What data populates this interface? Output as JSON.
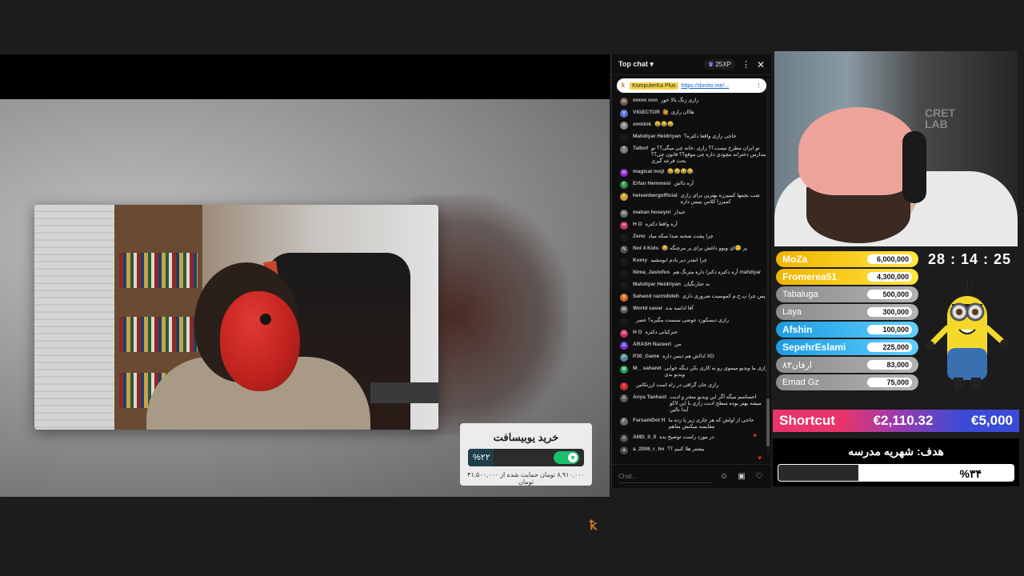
{
  "chat": {
    "header_title": "Top chat",
    "xp_label": "25XP",
    "pinned": {
      "name": "KomputerKa Plus",
      "link": "https://donito.me/..."
    },
    "messages": [
      {
        "author": "mmm nnn",
        "text": "رازی زنگ بالا خور",
        "avatar_color": "#6d5a50",
        "initial": "m"
      },
      {
        "author": "VIGECTOR",
        "text": "هااان رازی 🙋",
        "avatar_color": "#5a6fd0",
        "initial": "V"
      },
      {
        "author": "omidnk",
        "text": "😂😂😂",
        "avatar_color": "#888888",
        "initial": "o"
      },
      {
        "author": "Mahdiyar Heidriyan",
        "text": "حاجی رازی واقعا دکتره؟",
        "avatar_color": "#1a1a1a",
        "initial": ""
      },
      {
        "author": "Talbof",
        "text": "تو ایران مطرح نیست؟؟ رازی ،خانه چی میگی؟؟ تو مدارس دخترانه مچودی داره چی موقع؟؟ قانون چی؟؟ بحث قرعه گیری",
        "avatar_color": "#7a7a7a",
        "initial": "T"
      },
      {
        "author": "magical moji",
        "text": "😂😂😂😂",
        "avatar_color": "#8a2ad0",
        "initial": "m"
      },
      {
        "author": "Erfan Hemmesi",
        "text": "آره دااش",
        "avatar_color": "#2a8a4a",
        "initial": "E"
      },
      {
        "author": "heisenbergofficial",
        "text": "شب بچمها کمیپرزه بهترین برای رازی کمیرزا کلاس نیبس داره",
        "avatar_color": "#c89a3a",
        "initial": "h"
      },
      {
        "author": "mahan hoseyni",
        "text": "حیدار",
        "avatar_color": "#6a6a6a",
        "initial": "m"
      },
      {
        "author": "H O",
        "text": "آره واقعا دکتره",
        "avatar_color": "#c0306a",
        "initial": "H"
      },
      {
        "author": "Zeno",
        "text": "چرا پشت صحنه صدا سکه میاد",
        "avatar_color": "#1a1a1a",
        "initial": ""
      },
      {
        "author": "Not 4 Kids",
        "text": "پر ☺️ای ویوو داغش برای پر مرچنگه 😂",
        "avatar_color": "#4a4a4a",
        "initial": "N"
      },
      {
        "author": "Komy",
        "text": "چرا انقدر دیر یادم ابومشید",
        "avatar_color": "#1a1a1a",
        "initial": ""
      },
      {
        "author": "Nima_Jastofus",
        "text": "mahdiyar آره دکتره دکترا داره مترنگ هم",
        "avatar_color": "#1a1a1a",
        "initial": ""
      },
      {
        "author": "Mahdiyar Heidriyan",
        "text": "نه حتارنگیان",
        "avatar_color": "#1a1a1a",
        "initial": ""
      },
      {
        "author": "Sahand razmdideh",
        "text": "پس چرا پ.ج.م کموسیت ضروری داری",
        "avatar_color": "#d06a2a",
        "initial": "S"
      },
      {
        "author": "World savar",
        "text": "آقا اداسه بده",
        "avatar_color": "#5a5a5a",
        "initial": "W"
      },
      {
        "author": "",
        "text": "رازی دیسکورد عوضی سسنت مگیره؟ عصر",
        "avatar_color": "#1a1a1a",
        "initial": ""
      },
      {
        "author": "H O",
        "text": "حترکیانی دکتره",
        "avatar_color": "#c0306a",
        "initial": "H"
      },
      {
        "author": "ARASH Nazeeri",
        "text": "من",
        "avatar_color": "#6a3ad0",
        "initial": "A"
      },
      {
        "author": "P30_Game",
        "text": "XD ادااش هم دیس داره",
        "avatar_color": "#4a8a9a",
        "initial": "P"
      },
      {
        "author": "M__sahand",
        "text": "رازی ما ویدیو میموی رو به کاری بکن دیگه خوابی ویدیو بدی",
        "avatar_color": "#2a9a5a",
        "initial": "M"
      },
      {
        "author": "",
        "text": "رازی جان گرافی در راه است ازرنکاس",
        "avatar_color": "#d02a2a",
        "initial": "I"
      },
      {
        "author": "Anya Tanhast",
        "text": "احساسم میگه اگر این ویدیو منجر و ادیت میشه بهتر بوده سطح ادیت رازی با این لاکو آیدا بالین",
        "avatar_color": "#5a5a5a",
        "initial": "A"
      },
      {
        "author": "FarsamDot H",
        "text": "حاجی از اولش که هر چاری زیر پا زده ما مقایسه میکنش متاهم",
        "avatar_color": "#6a6a6a",
        "initial": "F"
      },
      {
        "author": "AMD_0_0",
        "text": "در مورد راست توضیح بده",
        "avatar_color": "#4a4a4a",
        "initial": "A"
      },
      {
        "author": "a_2006_r_hn",
        "text": "بیشتر هلا کنیم ؟؟",
        "avatar_color": "#4a4a4a",
        "initial": "a"
      }
    ],
    "input_placeholder": "Chat..."
  },
  "video": {
    "donate_title": "خرید یوبیسافت",
    "donate_percent_label": "%۲۲",
    "donate_progress": 0.22,
    "donate_sub": "۸,۹۱۰,۰۰۰ تومان حمایت شده از ۴۱,۵۰۰,۰۰۰ تومان"
  },
  "webcam": {
    "brand_line1": "CRET",
    "brand_line2": "LAB"
  },
  "leaderboard": [
    {
      "name": "MoZa",
      "amount": "6,000,000",
      "style": "gold"
    },
    {
      "name": "Fromerea51",
      "amount": "4,300,000",
      "style": "gold"
    },
    {
      "name": "Tabaluga",
      "amount": "500,000",
      "style": "gray"
    },
    {
      "name": "Laya",
      "amount": "300,000",
      "style": "gray"
    },
    {
      "name": "Afshin",
      "amount": "100,000",
      "style": "blue"
    },
    {
      "name": "SepehrEslami",
      "amount": "225,000",
      "style": "blue"
    },
    {
      "name": "ارفان۸۳",
      "amount": "83,000",
      "style": "gray"
    },
    {
      "name": "Emad Gz",
      "amount": "75,000",
      "style": "gray"
    }
  ],
  "timer": "28 : 14 : 25",
  "shortcut": {
    "label": "Shortcut",
    "current": "€2,110.32",
    "goal": "€5,000"
  },
  "goal": {
    "title": "هدف: شهریه مدرسه",
    "percent_label": "%۳۴",
    "progress": 0.34
  },
  "colors": {
    "accent_pink": "#e8356a",
    "accent_blue": "#3a4bd6",
    "gold": "#f0b400",
    "cyan": "#1e9be0"
  }
}
